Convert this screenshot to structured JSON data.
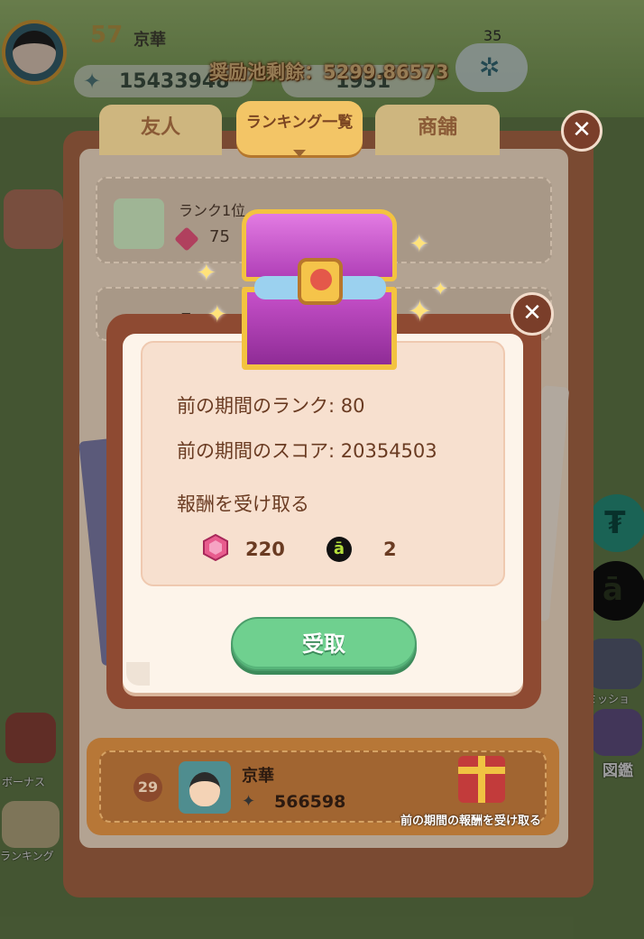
{
  "hud": {
    "level": "57",
    "player_name": "京華",
    "fish_balance": "15433948",
    "gem_balance": "1931",
    "reward_pool": "奨励池剩餘：5299.86573",
    "counter": "35"
  },
  "panel": {
    "tabs": [
      {
        "label": "友人"
      },
      {
        "label": "ランキング一覧"
      },
      {
        "label": "商舗"
      }
    ],
    "rows": [
      {
        "label": "ランク1位",
        "value": "75"
      },
      {
        "label": "ラ",
        "value": ""
      }
    ],
    "my_row": {
      "rank": "29",
      "name": "京華",
      "score": "566598",
      "claim_label": "前の期間の報酬を受け取る"
    }
  },
  "side_labels": {
    "mission": "ミッショ",
    "encyclopedia": "図鑑",
    "ranking": "ランキング",
    "bonus": "ボーナス"
  },
  "modal": {
    "prev_rank": "前の期間のランク: 80",
    "prev_score": "前の期間のスコア: 20354503",
    "reward_title": "報酬を受け取る",
    "rewards": [
      {
        "icon": "pink-gem-icon",
        "amount": "220"
      },
      {
        "icon": "ae-token-icon",
        "amount": "2"
      }
    ],
    "claim_button": "受取"
  },
  "colors": {
    "panel_brown": "#7a4a32",
    "tab_gold": "#f3c566",
    "claim_green": "#6fd08f",
    "modal_text": "#6a3b22"
  }
}
